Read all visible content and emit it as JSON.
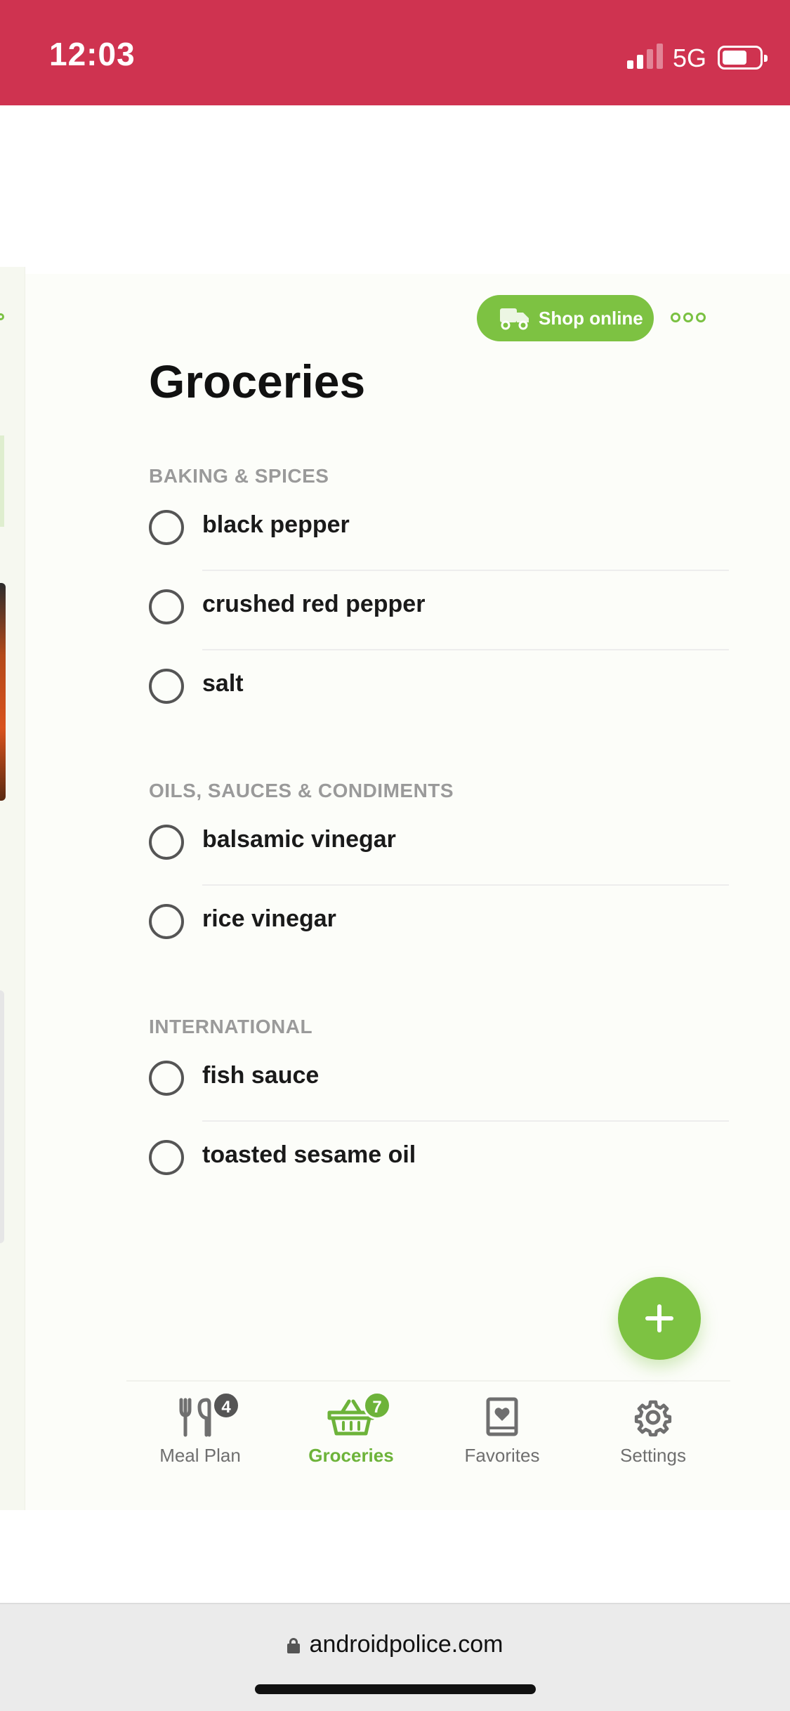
{
  "status_bar": {
    "time": "12:03",
    "network": "5G",
    "background_color": "#cf3350"
  },
  "header": {
    "shop_online_label": "Shop online",
    "title": "Groceries"
  },
  "sections": [
    {
      "title": "BAKING & SPICES",
      "items": [
        "black pepper",
        "crushed red pepper",
        "salt"
      ]
    },
    {
      "title": "OILS, SAUCES & CONDIMENTS",
      "items": [
        "balsamic vinegar",
        "rice vinegar"
      ]
    },
    {
      "title": "INTERNATIONAL",
      "items": [
        "fish sauce",
        "toasted sesame oil"
      ]
    }
  ],
  "bottom_nav": {
    "items": [
      {
        "label": "Meal Plan",
        "icon": "utensils-icon",
        "badge": "4",
        "active": false
      },
      {
        "label": "Groceries",
        "icon": "basket-icon",
        "badge": "7",
        "active": true
      },
      {
        "label": "Favorites",
        "icon": "bookmark-heart-icon",
        "badge": null,
        "active": false
      },
      {
        "label": "Settings",
        "icon": "gear-icon",
        "badge": null,
        "active": false
      }
    ]
  },
  "browser": {
    "url": "androidpolice.com"
  },
  "colors": {
    "accent": "#7dc242",
    "active_nav": "#6db33a",
    "badge_gray": "#555555",
    "section_title": "#9a9a9a"
  }
}
